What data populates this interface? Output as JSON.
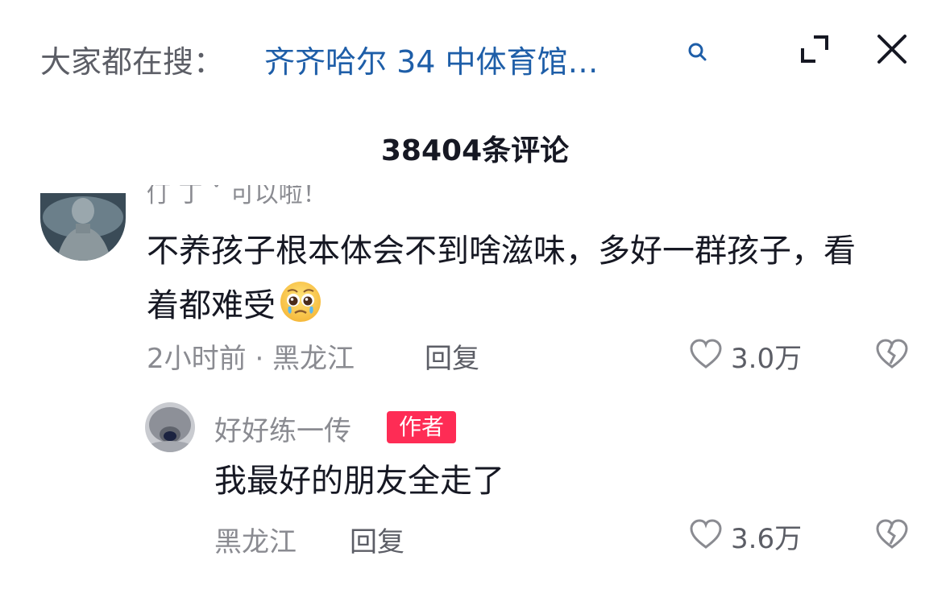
{
  "search": {
    "prefix": "大家都在搜：",
    "term": "齐齐哈尔 34 中体育馆…"
  },
  "comments_header": {
    "title": "38404条评论"
  },
  "comment": {
    "cut_off_text": "仃 丁 ˇ 可以啦！",
    "text": "不养孩子根本体会不到啥滋味，多好一群孩子，看着都难受",
    "emoji": "pleading-face",
    "meta": "2小时前 · 黑龙江",
    "reply_label": "回复",
    "likes": "3.0万"
  },
  "reply": {
    "username": "好好练一传",
    "badge": "作者",
    "text": "我最好的朋友全走了",
    "meta": "黑龙江",
    "reply_label": "回复",
    "likes": "3.6万"
  },
  "icons": {
    "search": "search-icon",
    "expand": "expand-icon",
    "close": "close-icon",
    "like": "heart-outline-icon",
    "dislike": "broken-heart-icon"
  },
  "colors": {
    "link": "#1e5ea8",
    "badge": "#fe2c55",
    "text": "#161823",
    "muted": "#8a8b91"
  }
}
